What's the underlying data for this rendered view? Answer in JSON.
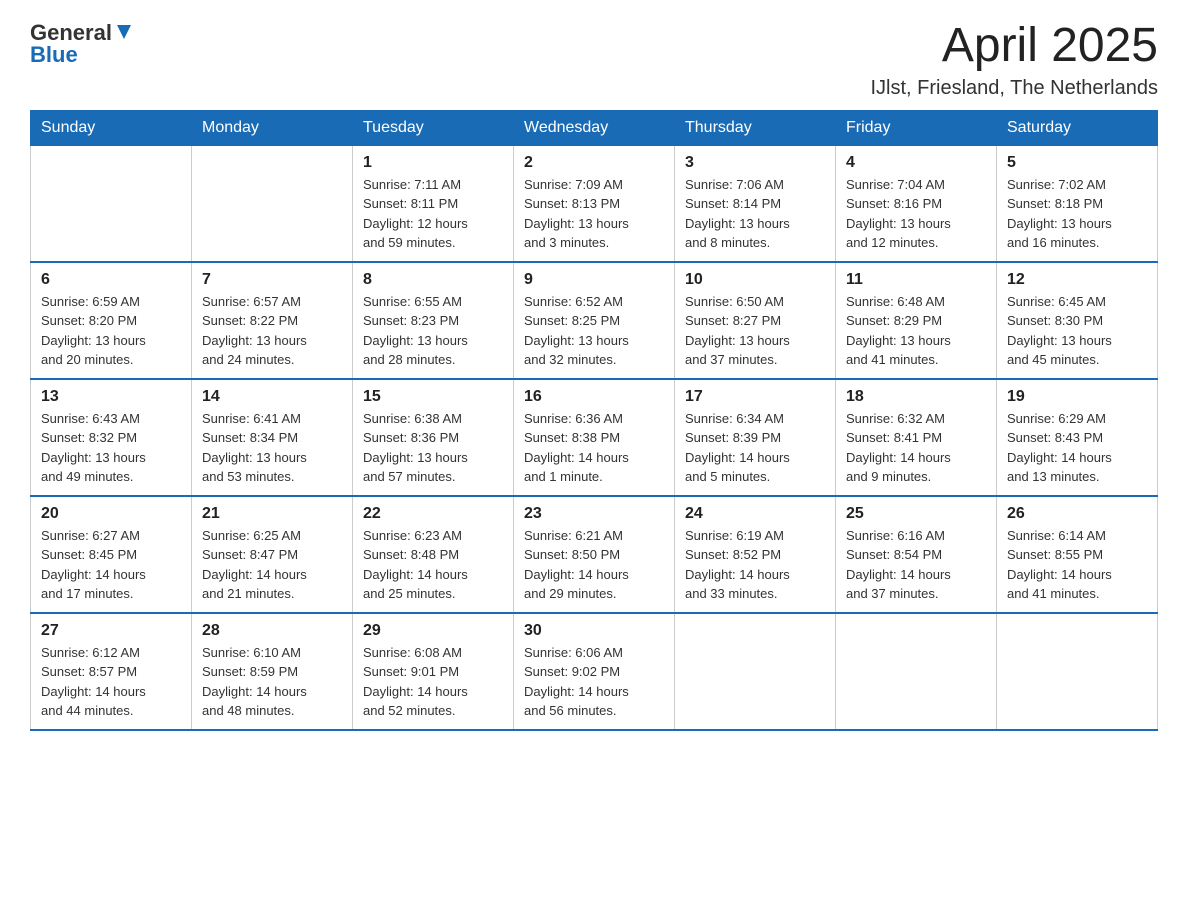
{
  "header": {
    "logo_general": "General",
    "logo_blue": "Blue",
    "month_title": "April 2025",
    "location": "IJlst, Friesland, The Netherlands"
  },
  "weekdays": [
    "Sunday",
    "Monday",
    "Tuesday",
    "Wednesday",
    "Thursday",
    "Friday",
    "Saturday"
  ],
  "weeks": [
    [
      {
        "day": "",
        "info": ""
      },
      {
        "day": "",
        "info": ""
      },
      {
        "day": "1",
        "info": "Sunrise: 7:11 AM\nSunset: 8:11 PM\nDaylight: 12 hours\nand 59 minutes."
      },
      {
        "day": "2",
        "info": "Sunrise: 7:09 AM\nSunset: 8:13 PM\nDaylight: 13 hours\nand 3 minutes."
      },
      {
        "day": "3",
        "info": "Sunrise: 7:06 AM\nSunset: 8:14 PM\nDaylight: 13 hours\nand 8 minutes."
      },
      {
        "day": "4",
        "info": "Sunrise: 7:04 AM\nSunset: 8:16 PM\nDaylight: 13 hours\nand 12 minutes."
      },
      {
        "day": "5",
        "info": "Sunrise: 7:02 AM\nSunset: 8:18 PM\nDaylight: 13 hours\nand 16 minutes."
      }
    ],
    [
      {
        "day": "6",
        "info": "Sunrise: 6:59 AM\nSunset: 8:20 PM\nDaylight: 13 hours\nand 20 minutes."
      },
      {
        "day": "7",
        "info": "Sunrise: 6:57 AM\nSunset: 8:22 PM\nDaylight: 13 hours\nand 24 minutes."
      },
      {
        "day": "8",
        "info": "Sunrise: 6:55 AM\nSunset: 8:23 PM\nDaylight: 13 hours\nand 28 minutes."
      },
      {
        "day": "9",
        "info": "Sunrise: 6:52 AM\nSunset: 8:25 PM\nDaylight: 13 hours\nand 32 minutes."
      },
      {
        "day": "10",
        "info": "Sunrise: 6:50 AM\nSunset: 8:27 PM\nDaylight: 13 hours\nand 37 minutes."
      },
      {
        "day": "11",
        "info": "Sunrise: 6:48 AM\nSunset: 8:29 PM\nDaylight: 13 hours\nand 41 minutes."
      },
      {
        "day": "12",
        "info": "Sunrise: 6:45 AM\nSunset: 8:30 PM\nDaylight: 13 hours\nand 45 minutes."
      }
    ],
    [
      {
        "day": "13",
        "info": "Sunrise: 6:43 AM\nSunset: 8:32 PM\nDaylight: 13 hours\nand 49 minutes."
      },
      {
        "day": "14",
        "info": "Sunrise: 6:41 AM\nSunset: 8:34 PM\nDaylight: 13 hours\nand 53 minutes."
      },
      {
        "day": "15",
        "info": "Sunrise: 6:38 AM\nSunset: 8:36 PM\nDaylight: 13 hours\nand 57 minutes."
      },
      {
        "day": "16",
        "info": "Sunrise: 6:36 AM\nSunset: 8:38 PM\nDaylight: 14 hours\nand 1 minute."
      },
      {
        "day": "17",
        "info": "Sunrise: 6:34 AM\nSunset: 8:39 PM\nDaylight: 14 hours\nand 5 minutes."
      },
      {
        "day": "18",
        "info": "Sunrise: 6:32 AM\nSunset: 8:41 PM\nDaylight: 14 hours\nand 9 minutes."
      },
      {
        "day": "19",
        "info": "Sunrise: 6:29 AM\nSunset: 8:43 PM\nDaylight: 14 hours\nand 13 minutes."
      }
    ],
    [
      {
        "day": "20",
        "info": "Sunrise: 6:27 AM\nSunset: 8:45 PM\nDaylight: 14 hours\nand 17 minutes."
      },
      {
        "day": "21",
        "info": "Sunrise: 6:25 AM\nSunset: 8:47 PM\nDaylight: 14 hours\nand 21 minutes."
      },
      {
        "day": "22",
        "info": "Sunrise: 6:23 AM\nSunset: 8:48 PM\nDaylight: 14 hours\nand 25 minutes."
      },
      {
        "day": "23",
        "info": "Sunrise: 6:21 AM\nSunset: 8:50 PM\nDaylight: 14 hours\nand 29 minutes."
      },
      {
        "day": "24",
        "info": "Sunrise: 6:19 AM\nSunset: 8:52 PM\nDaylight: 14 hours\nand 33 minutes."
      },
      {
        "day": "25",
        "info": "Sunrise: 6:16 AM\nSunset: 8:54 PM\nDaylight: 14 hours\nand 37 minutes."
      },
      {
        "day": "26",
        "info": "Sunrise: 6:14 AM\nSunset: 8:55 PM\nDaylight: 14 hours\nand 41 minutes."
      }
    ],
    [
      {
        "day": "27",
        "info": "Sunrise: 6:12 AM\nSunset: 8:57 PM\nDaylight: 14 hours\nand 44 minutes."
      },
      {
        "day": "28",
        "info": "Sunrise: 6:10 AM\nSunset: 8:59 PM\nDaylight: 14 hours\nand 48 minutes."
      },
      {
        "day": "29",
        "info": "Sunrise: 6:08 AM\nSunset: 9:01 PM\nDaylight: 14 hours\nand 52 minutes."
      },
      {
        "day": "30",
        "info": "Sunrise: 6:06 AM\nSunset: 9:02 PM\nDaylight: 14 hours\nand 56 minutes."
      },
      {
        "day": "",
        "info": ""
      },
      {
        "day": "",
        "info": ""
      },
      {
        "day": "",
        "info": ""
      }
    ]
  ]
}
